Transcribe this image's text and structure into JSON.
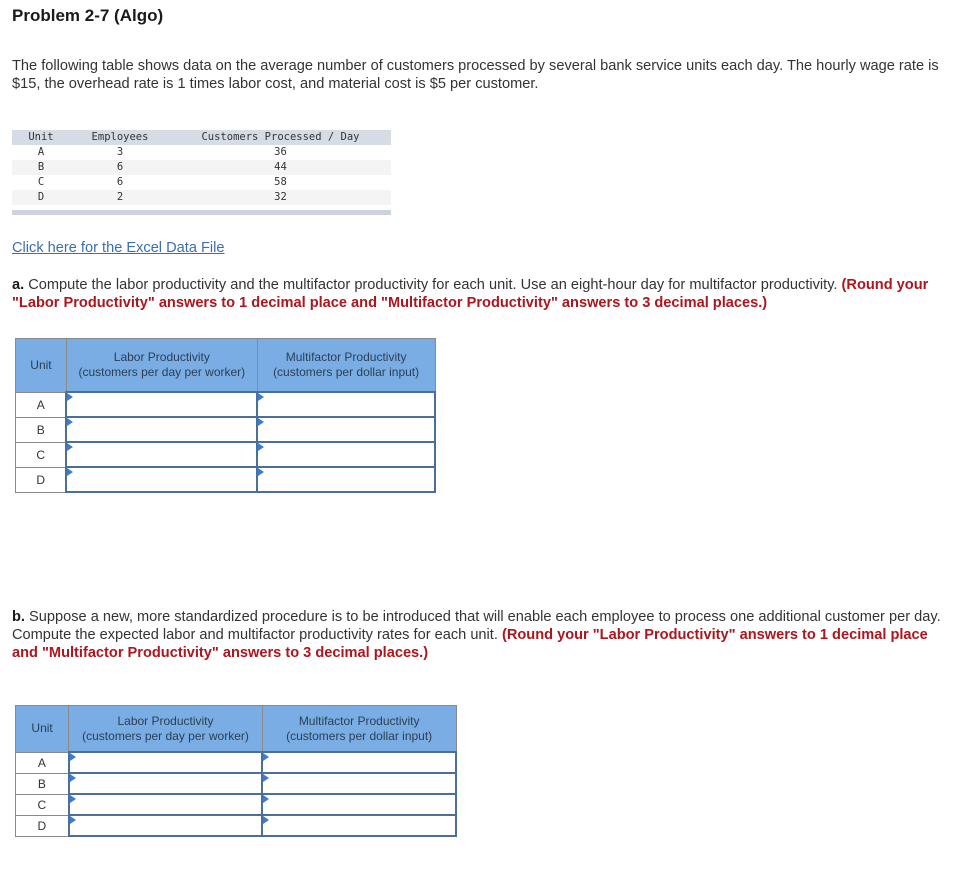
{
  "title": "Problem 2-7 (Algo)",
  "intro": "The following table shows data on the average number of customers processed by several bank service units each day. The hourly wage rate is $15, the overhead rate is 1 times labor cost, and material cost is $5 per customer.",
  "data_table": {
    "headers": [
      "Unit",
      "Employees",
      "Customers Processed / Day"
    ],
    "rows": [
      {
        "unit": "A",
        "employees": "3",
        "customers": "36"
      },
      {
        "unit": "B",
        "employees": "6",
        "customers": "44"
      },
      {
        "unit": "C",
        "employees": "6",
        "customers": "58"
      },
      {
        "unit": "D",
        "employees": "2",
        "customers": "32"
      }
    ]
  },
  "excel_link": "Click here for the Excel Data File",
  "part_a": {
    "label": "a.",
    "text": " Compute the labor productivity and the multifactor productivity for each unit. Use an eight-hour day for multifactor productivity. ",
    "hint": "(Round your \"Labor Productivity\" answers to 1 decimal place and \"Multifactor Productivity\" answers to 3 decimal places.)",
    "table": {
      "header_unit": "Unit",
      "header_labor_1": "Labor Productivity",
      "header_labor_2": "(customers per day per worker)",
      "header_multi_1": "Multifactor Productivity",
      "header_multi_2": "(customers per dollar input)",
      "rows": [
        {
          "unit": "A",
          "labor": "",
          "multi": ""
        },
        {
          "unit": "B",
          "labor": "",
          "multi": ""
        },
        {
          "unit": "C",
          "labor": "",
          "multi": ""
        },
        {
          "unit": "D",
          "labor": "",
          "multi": ""
        }
      ]
    }
  },
  "part_b": {
    "label": "b.",
    "text": " Suppose a new, more standardized procedure is to be introduced that will enable each employee to process one additional customer per day. Compute the expected labor and multifactor productivity rates for each unit. ",
    "hint": "(Round your \"Labor Productivity\" answers to 1 decimal place and \"Multifactor Productivity\" answers to 3 decimal places.)",
    "table": {
      "header_unit": "Unit",
      "header_labor_1": "Labor Productivity",
      "header_labor_2": "(customers per day per worker)",
      "header_multi_1": "Multifactor Productivity",
      "header_multi_2": "(customers per dollar input)",
      "rows": [
        {
          "unit": "A",
          "labor": "",
          "multi": ""
        },
        {
          "unit": "B",
          "labor": "",
          "multi": ""
        },
        {
          "unit": "C",
          "labor": "",
          "multi": ""
        },
        {
          "unit": "D",
          "labor": "",
          "multi": ""
        }
      ]
    }
  },
  "colors": {
    "hint_red": "#b0141c",
    "link_blue": "#3a6fb0",
    "table_header_blue": "#7aade3",
    "input_border": "#4a6f9a"
  }
}
